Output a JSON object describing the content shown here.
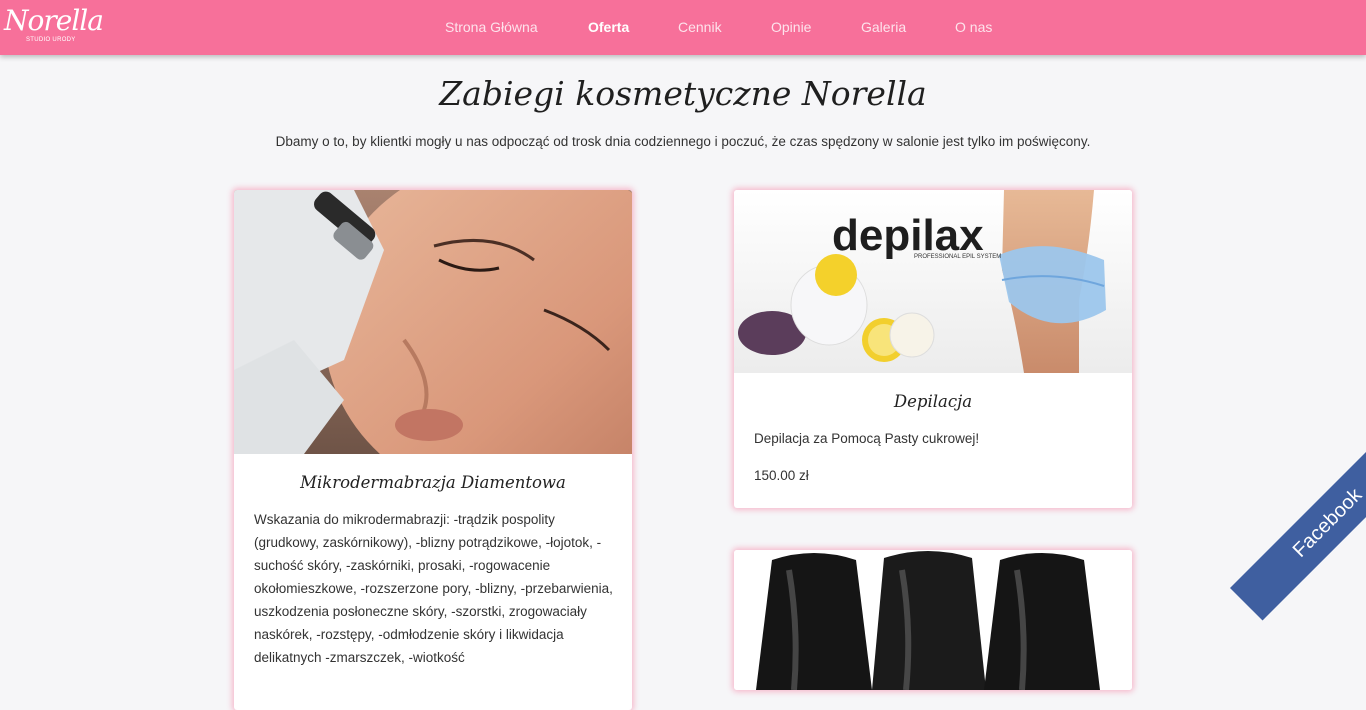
{
  "header": {
    "logo_text": "Norella",
    "logo_subtext": "STUDIO URODY",
    "nav": [
      {
        "label": "Strona Główna",
        "active": false
      },
      {
        "label": "Oferta",
        "active": true
      },
      {
        "label": "Cennik",
        "active": false
      },
      {
        "label": "Opinie",
        "active": false
      },
      {
        "label": "Galeria",
        "active": false
      },
      {
        "label": "O nas",
        "active": false
      }
    ]
  },
  "hero": {
    "title": "Zabiegi kosmetyczne Norella",
    "subtitle": "Dbamy o to, by klientki mogły u nas odpocząć od trosk dnia codziennego i poczuć, że czas spędzony w salonie jest tylko im poświęcony."
  },
  "cards": [
    {
      "title": "Mikrodermabrazja Diamentowa",
      "description": "Wskazania do mikrodermabrazji: -trądzik pospolity (grudkowy, zaskórnikowy), -blizny potrądzikowe, -łojotok, -suchość skóry, -zaskórniki, prosaki, -rogowacenie okołomieszkowe, -rozszerzone pory, -blizny, -przebarwienia, uszkodzenia posłoneczne skóry, -szorstki, zrogowaciały naskórek, -rozstępy, -odmłodzenie skóry i likwidacja delikatnych -zmarszczek, -wiotkość"
    },
    {
      "title": "Depilacja",
      "description": "Depilacja za Pomocą Pasty cukrowej!",
      "price": "150.00 zł",
      "image_brand": "depilax",
      "image_brand_sub": "PROFESSIONAL EPIL SYSTEM"
    },
    {
      "title": ""
    }
  ],
  "social": {
    "facebook_label": "Facebook"
  },
  "colors": {
    "brand_pink": "#f7709a",
    "facebook_blue": "#3f5fa0"
  }
}
